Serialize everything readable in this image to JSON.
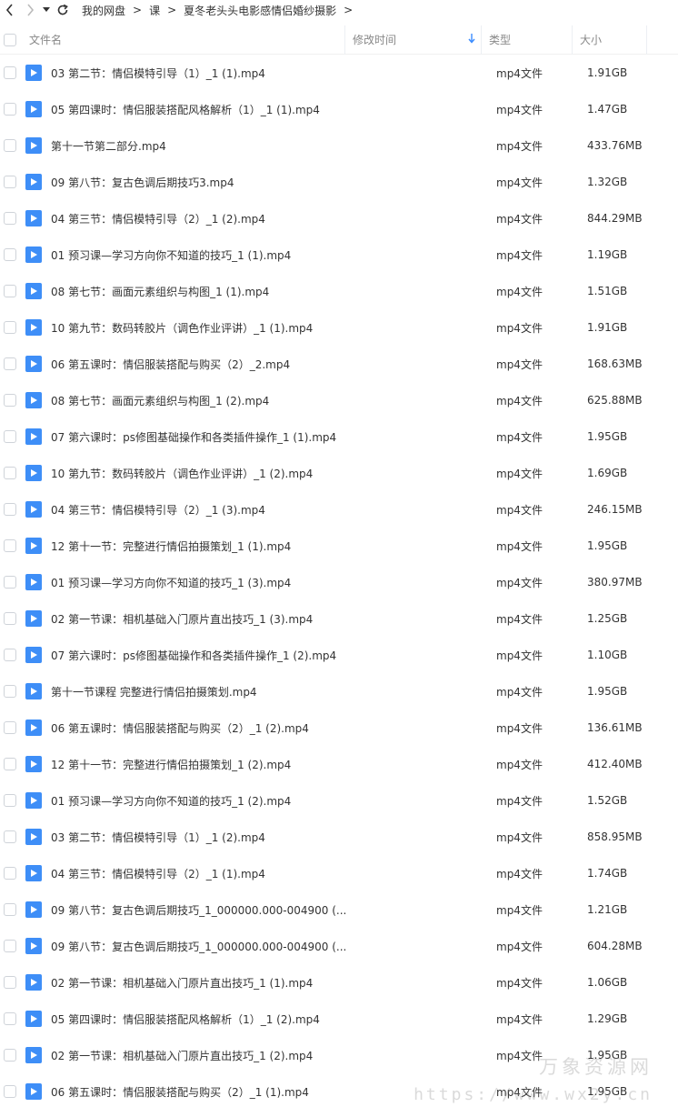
{
  "toolbar": {
    "back_icon": "chevron-left-icon",
    "forward_icon": "chevron-right-icon",
    "dropdown_icon": "caret-down-icon",
    "refresh_icon": "refresh-icon"
  },
  "breadcrumb": [
    "我的网盘",
    "课",
    "夏冬老头头电影感情侣婚纱摄影"
  ],
  "columns": {
    "name": "文件名",
    "modified": "修改时间",
    "type": "类型",
    "size": "大小",
    "sort_icon": "arrow-down-icon"
  },
  "colors": {
    "accent": "#3e8ef7",
    "file_icon": "#3e8ef7"
  },
  "files": [
    {
      "name": "03  第二节：情侣模特引导（1）_1 (1).mp4",
      "type": "mp4文件",
      "size": "1.91GB"
    },
    {
      "name": "05  第四课时：情侣服装搭配风格解析（1）_1 (1).mp4",
      "type": "mp4文件",
      "size": "1.47GB"
    },
    {
      "name": "第十一节第二部分.mp4",
      "type": "mp4文件",
      "size": "433.76MB"
    },
    {
      "name": "09  第八节：复古色调后期技巧3.mp4",
      "type": "mp4文件",
      "size": "1.32GB"
    },
    {
      "name": "04  第三节：情侣模特引导（2）_1 (2).mp4",
      "type": "mp4文件",
      "size": "844.29MB"
    },
    {
      "name": "01  预习课—学习方向你不知道的技巧_1 (1).mp4",
      "type": "mp4文件",
      "size": "1.19GB"
    },
    {
      "name": "08  第七节：画面元素组织与构图_1 (1).mp4",
      "type": "mp4文件",
      "size": "1.51GB"
    },
    {
      "name": "10  第九节：数码转胶片（调色作业评讲）_1 (1).mp4",
      "type": "mp4文件",
      "size": "1.91GB"
    },
    {
      "name": "06  第五课时：情侣服装搭配与购买（2）_2.mp4",
      "type": "mp4文件",
      "size": "168.63MB"
    },
    {
      "name": "08  第七节：画面元素组织与构图_1 (2).mp4",
      "type": "mp4文件",
      "size": "625.88MB"
    },
    {
      "name": "07  第六课时：ps修图基础操作和各类插件操作_1 (1).mp4",
      "type": "mp4文件",
      "size": "1.95GB"
    },
    {
      "name": "10  第九节：数码转胶片（调色作业评讲）_1 (2).mp4",
      "type": "mp4文件",
      "size": "1.69GB"
    },
    {
      "name": "04  第三节：情侣模特引导（2）_1 (3).mp4",
      "type": "mp4文件",
      "size": "246.15MB"
    },
    {
      "name": "12  第十一节：完整进行情侣拍摄策划_1 (1).mp4",
      "type": "mp4文件",
      "size": "1.95GB"
    },
    {
      "name": "01  预习课—学习方向你不知道的技巧_1 (3).mp4",
      "type": "mp4文件",
      "size": "380.97MB"
    },
    {
      "name": "02  第一节课：相机基础入门原片直出技巧_1 (3).mp4",
      "type": "mp4文件",
      "size": "1.25GB"
    },
    {
      "name": "07  第六课时：ps修图基础操作和各类插件操作_1 (2).mp4",
      "type": "mp4文件",
      "size": "1.10GB"
    },
    {
      "name": "第十一节课程 完整进行情侣拍摄策划.mp4",
      "type": "mp4文件",
      "size": "1.95GB"
    },
    {
      "name": "06  第五课时：情侣服装搭配与购买（2）_1 (2).mp4",
      "type": "mp4文件",
      "size": "136.61MB"
    },
    {
      "name": "12  第十一节：完整进行情侣拍摄策划_1 (2).mp4",
      "type": "mp4文件",
      "size": "412.40MB"
    },
    {
      "name": "01  预习课—学习方向你不知道的技巧_1 (2).mp4",
      "type": "mp4文件",
      "size": "1.52GB"
    },
    {
      "name": "03  第二节：情侣模特引导（1）_1 (2).mp4",
      "type": "mp4文件",
      "size": "858.95MB"
    },
    {
      "name": "04  第三节：情侣模特引导（2）_1 (1).mp4",
      "type": "mp4文件",
      "size": "1.74GB"
    },
    {
      "name": "09  第八节：复古色调后期技巧_1_000000.000-004900 (...",
      "type": "mp4文件",
      "size": "1.21GB"
    },
    {
      "name": "09  第八节：复古色调后期技巧_1_000000.000-004900 (...",
      "type": "mp4文件",
      "size": "604.28MB"
    },
    {
      "name": "02  第一节课：相机基础入门原片直出技巧_1 (1).mp4",
      "type": "mp4文件",
      "size": "1.06GB"
    },
    {
      "name": "05  第四课时：情侣服装搭配风格解析（1）_1 (2).mp4",
      "type": "mp4文件",
      "size": "1.29GB"
    },
    {
      "name": "02  第一节课：相机基础入门原片直出技巧_1 (2).mp4",
      "type": "mp4文件",
      "size": "1.95GB"
    },
    {
      "name": "06  第五课时：情侣服装搭配与购买（2）_1 (1).mp4",
      "type": "mp4文件",
      "size": "1.95GB"
    }
  ],
  "watermark": {
    "text": "万象资源网",
    "url": "https://www.wx2y.cn"
  }
}
